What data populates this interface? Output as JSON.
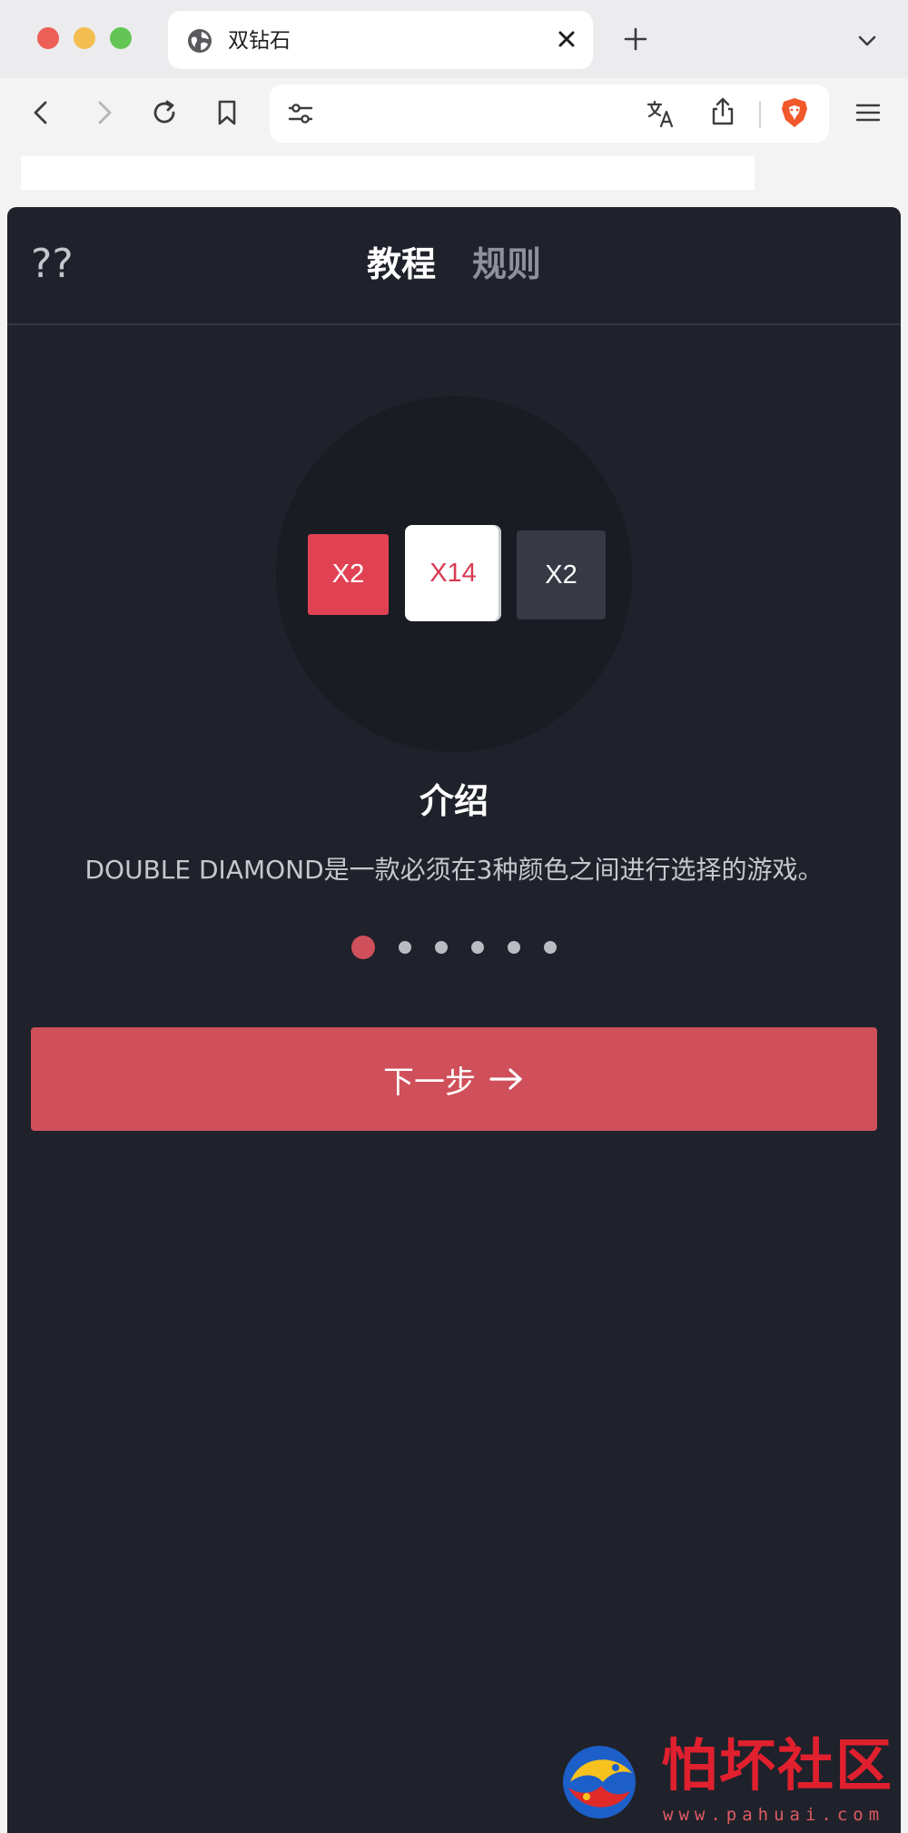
{
  "browser": {
    "tab_title": "双钻石",
    "icons": {
      "tab": "globe-icon",
      "close": "close-icon",
      "new_tab": "plus-icon",
      "tab_list": "chevron-down-icon",
      "back": "back-arrow-icon",
      "forward": "forward-arrow-icon",
      "reload": "reload-icon",
      "bookmark": "bookmark-icon",
      "site_settings": "tune-icon",
      "translate": "translate-icon",
      "share": "share-icon",
      "shield": "brave-shield-icon",
      "menu": "hamburger-menu-icon"
    }
  },
  "app": {
    "help_text": "??",
    "tabs": [
      {
        "label": "教程",
        "active": true
      },
      {
        "label": "规则",
        "active": false
      }
    ],
    "chips": [
      {
        "label": "X2",
        "color": "#e04254"
      },
      {
        "label": "X14",
        "color": "#ffffff"
      },
      {
        "label": "X2",
        "color": "#373a45"
      }
    ],
    "intro_title": "介绍",
    "intro_description": "DOUBLE DIAMOND是一款必须在3种颜色之间进行选择的游戏。",
    "pagination": {
      "total": 6,
      "current": 1
    },
    "next_button_label": "下一步",
    "accent_color": "#cf4f5a",
    "background_color": "#1f222a"
  },
  "watermark": {
    "text": "怕坏社区",
    "url": "www.pahuai.com"
  }
}
